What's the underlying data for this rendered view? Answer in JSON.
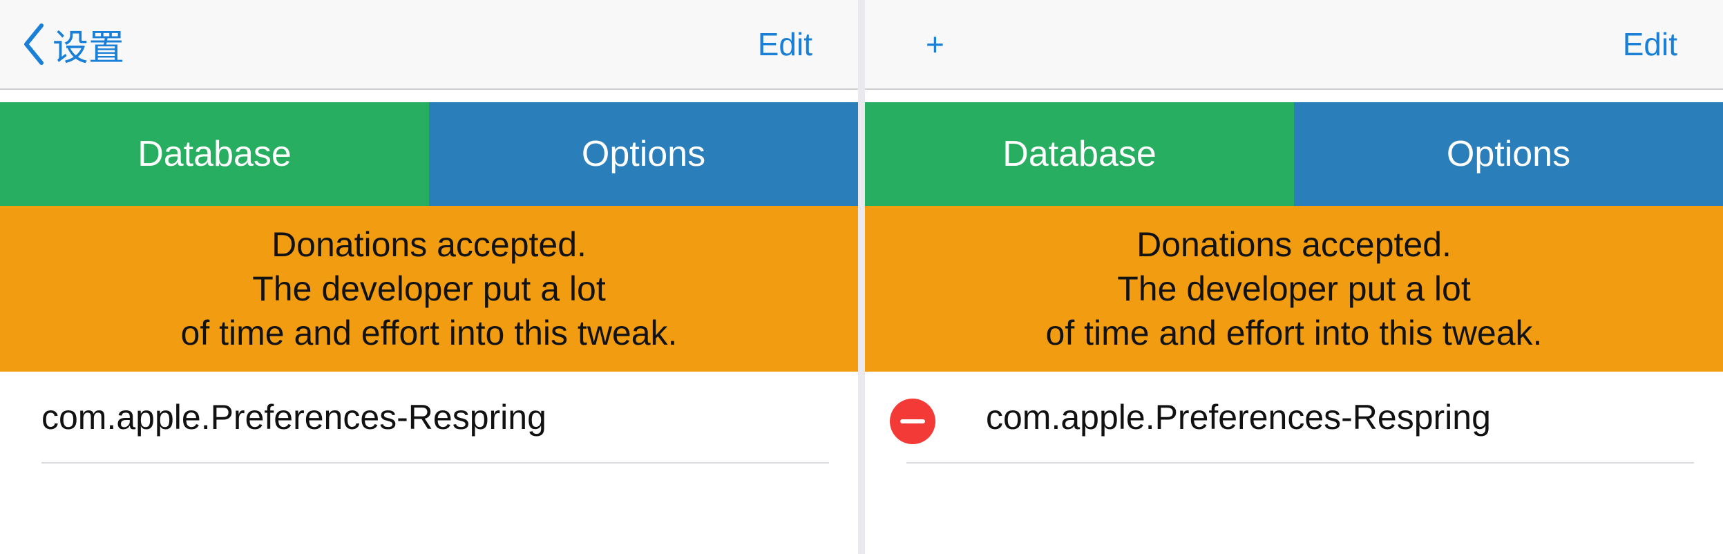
{
  "left": {
    "navbar": {
      "back_label": "设置",
      "edit_label": "Edit"
    },
    "tabs": [
      {
        "label": "Database"
      },
      {
        "label": "Options"
      }
    ],
    "banner": {
      "lines": [
        "Donations accepted.",
        "The developer put a lot",
        "of time and effort into this tweak."
      ]
    },
    "list": {
      "items": [
        {
          "label": "com.apple.Preferences-Respring"
        }
      ]
    }
  },
  "right": {
    "navbar": {
      "add_label": "+",
      "edit_label": "Edit"
    },
    "tabs": [
      {
        "label": "Database"
      },
      {
        "label": "Options"
      }
    ],
    "banner": {
      "lines": [
        "Donations accepted.",
        "The developer put a lot",
        "of time and effort into this tweak."
      ]
    },
    "list": {
      "items": [
        {
          "label": "com.apple.Preferences-Respring"
        }
      ]
    }
  },
  "colors": {
    "tint": "#1a7fd6",
    "database_tab": "#27ae60",
    "options_tab": "#2a7fbb",
    "banner": "#f29c12",
    "delete": "#f43a36"
  },
  "icons": {
    "back": "chevron-left-icon",
    "delete": "minus-circle-icon"
  }
}
